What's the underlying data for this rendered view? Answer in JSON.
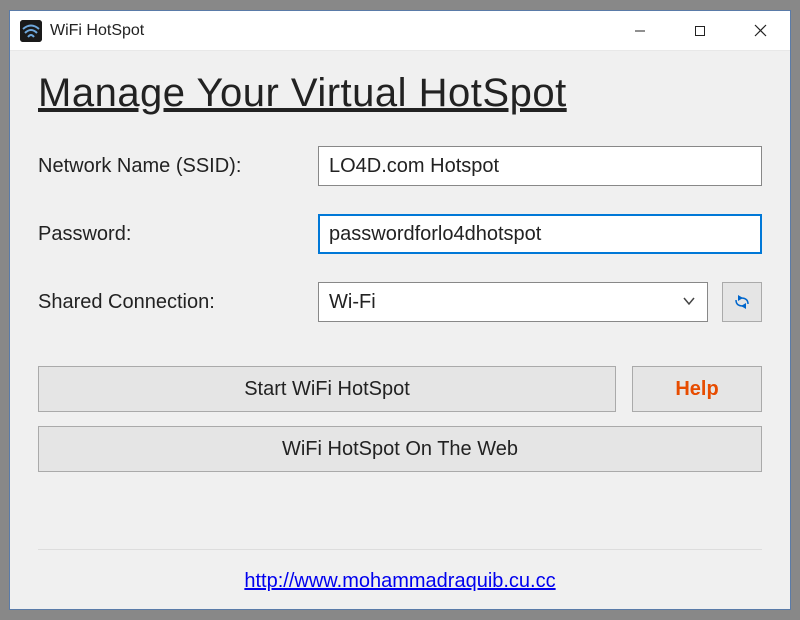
{
  "window": {
    "title": "WiFi HotSpot"
  },
  "page": {
    "heading": "Manage Your Virtual HotSpot"
  },
  "form": {
    "ssid_label": "Network Name (SSID):",
    "ssid_value": "LO4D.com Hotspot",
    "password_label": "Password:",
    "password_value": "passwordforlo4dhotspot",
    "shared_label": "Shared Connection:",
    "shared_value": "Wi-Fi"
  },
  "buttons": {
    "start": "Start WiFi HotSpot",
    "help": "Help",
    "web": "WiFi HotSpot On The Web"
  },
  "footer": {
    "link": "http://www.mohammadraquib.cu.cc"
  }
}
